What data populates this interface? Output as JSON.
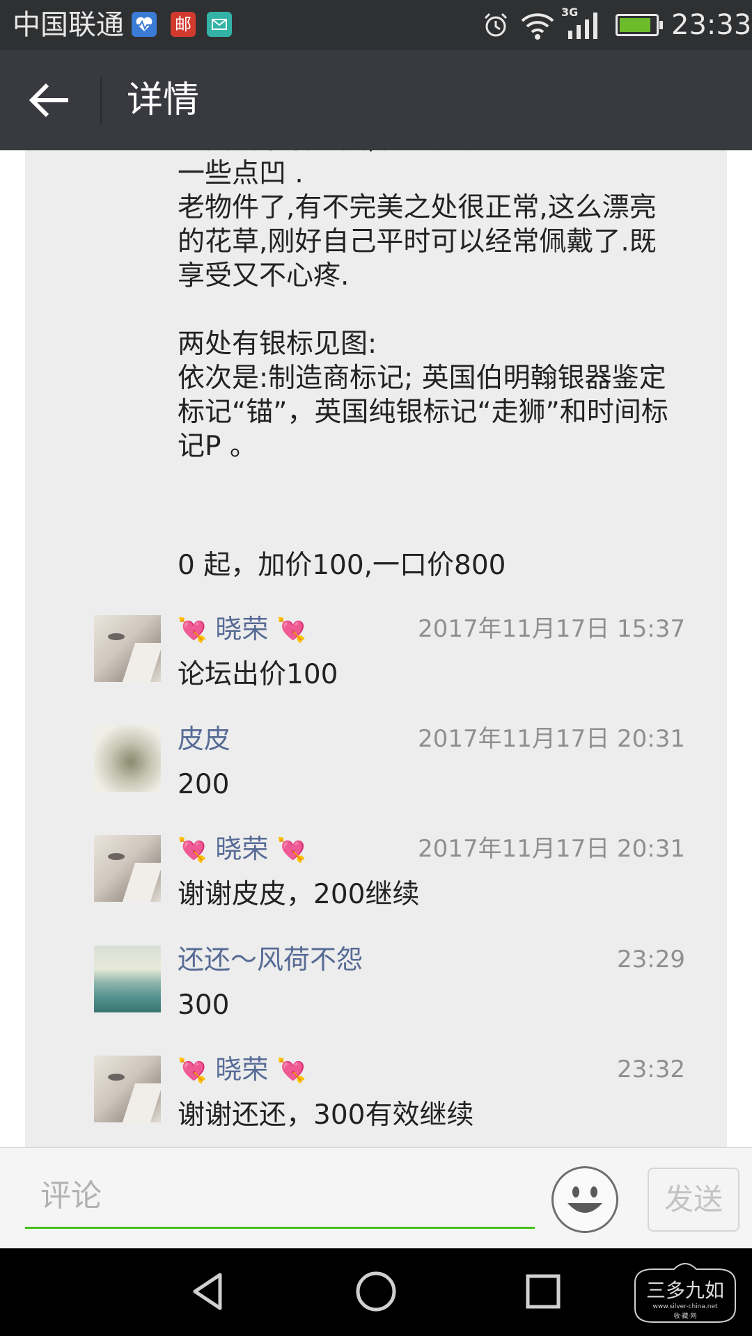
{
  "status_bar": {
    "carrier": "中国联通",
    "network": "3G",
    "time": "23:33",
    "battery_level": 0.9,
    "notification_icons": [
      "health-icon",
      "mail-icon",
      "message-icon"
    ],
    "mail_glyph": "邮"
  },
  "header": {
    "title": "详情",
    "back_icon": "arrow-left-icon"
  },
  "post": {
    "body": "背面看最后一图,有两处较大点的凹陷和\n一些点凹 .\n老物件了,有不完美之处很正常,这么漂亮\n的花草,刚好自己平时可以经常佩戴了.既\n享受又不心疼.\n\n两处有银标见图:\n依次是:制造商标记; 英国伯明翰银器鉴定\n标记“锚”，英国纯银标记“走狮”和时间标\n记P 。",
    "price_line": "0 起，加价100,一口价800"
  },
  "comments": [
    {
      "name_prefix": "💘",
      "name": " 晓荣 ",
      "name_suffix": "💘",
      "time": "2017年11月17日 15:37",
      "text": "论坛出价100",
      "avatar": "face"
    },
    {
      "name_prefix": "",
      "name": "皮皮",
      "name_suffix": "",
      "time": "2017年11月17日 20:31",
      "text": "200",
      "avatar": "dragon"
    },
    {
      "name_prefix": "💘",
      "name": " 晓荣 ",
      "name_suffix": "💘",
      "time": "2017年11月17日 20:31",
      "text": "谢谢皮皮，200继续",
      "avatar": "face"
    },
    {
      "name_prefix": "",
      "name": "还还～风荷不怨",
      "name_suffix": "",
      "time": "23:29",
      "text": "300",
      "avatar": "sea"
    },
    {
      "name_prefix": "💘",
      "name": " 晓荣 ",
      "name_suffix": "💘",
      "time": "23:32",
      "text": "谢谢还还，300有效继续",
      "avatar": "face"
    }
  ],
  "input_bar": {
    "placeholder": "评论",
    "emoji_icon": "smiley-icon",
    "send_label": "发送"
  },
  "nav_bar": {
    "icons": [
      "back-triangle-icon",
      "home-circle-icon",
      "recent-square-icon"
    ]
  },
  "watermark": {
    "title": "三多九如",
    "url": "www.silver-china.net",
    "caption": "收·藏·网"
  },
  "colors": {
    "title_bar": "#393a3f",
    "status_bar": "#2f3032",
    "name_link": "#576b95",
    "input_underline": "#45c01a",
    "panel": "#ededed"
  }
}
